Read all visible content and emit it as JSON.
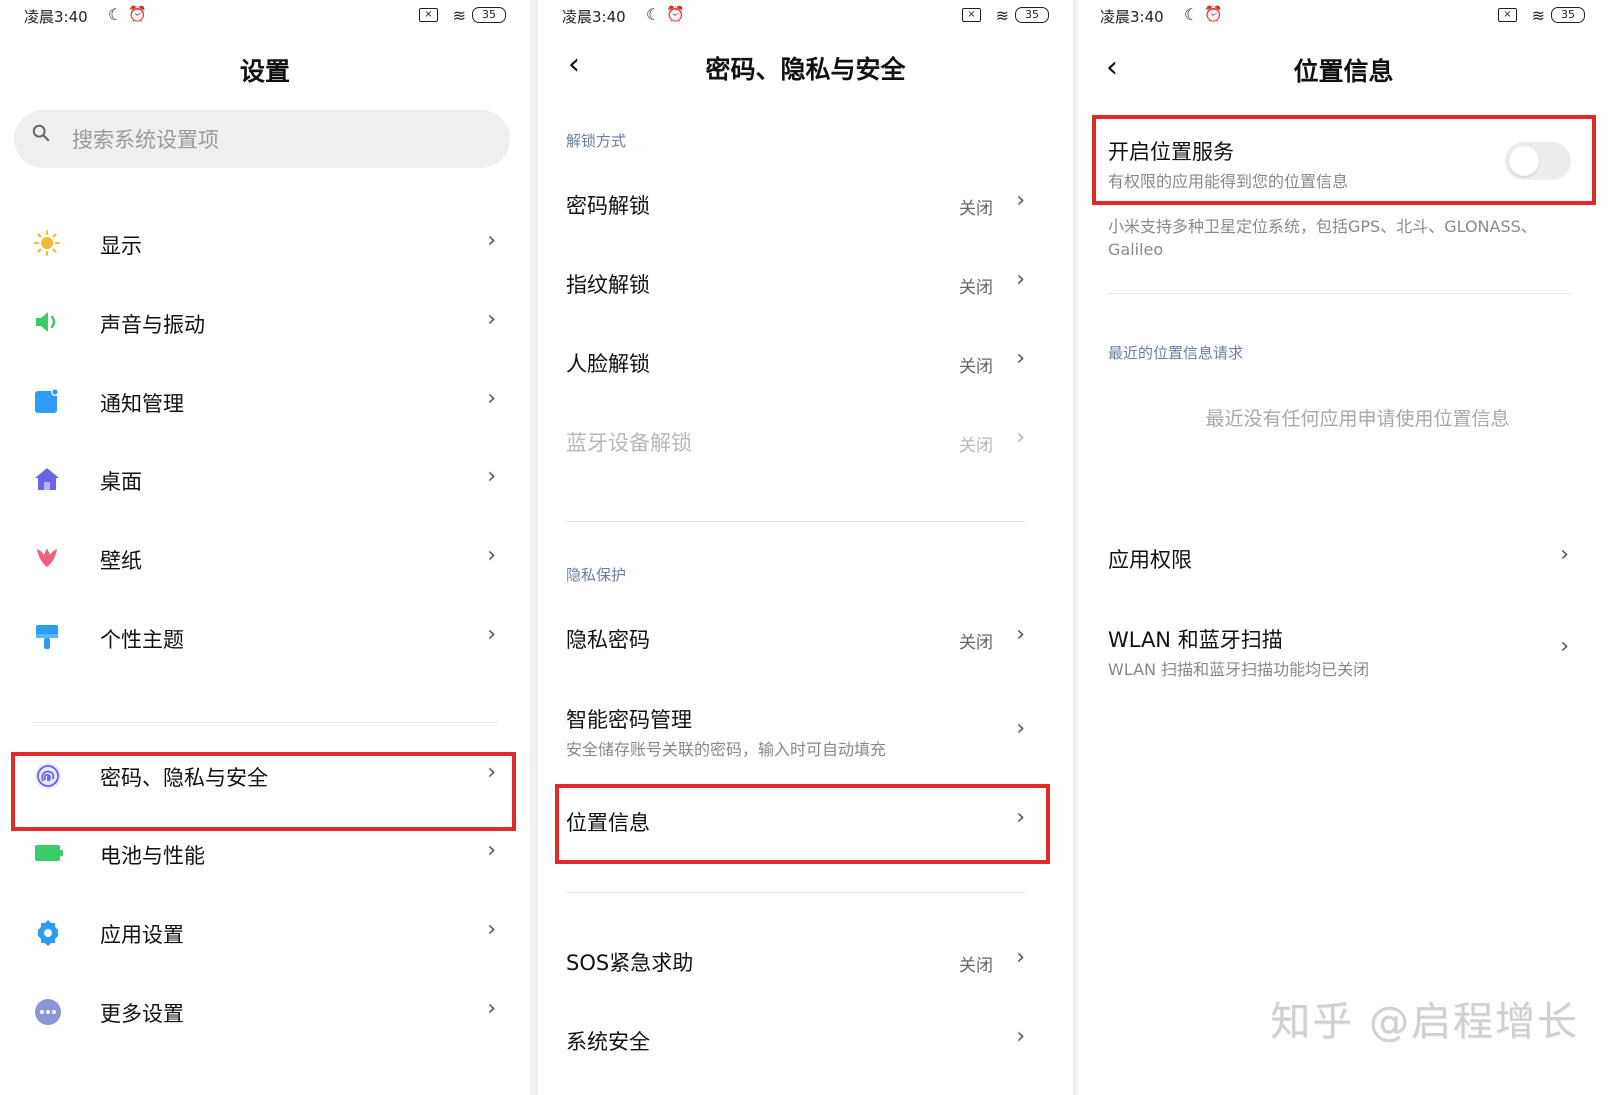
{
  "status_bar": {
    "time": "凌晨3:40",
    "battery": "35"
  },
  "panel1": {
    "title": "设置",
    "search_placeholder": "搜索系统设置项",
    "items": [
      {
        "label": "显示",
        "icon": "sun-icon",
        "color": "#f5b82e"
      },
      {
        "label": "声音与振动",
        "icon": "speaker-icon",
        "color": "#3ccb6a"
      },
      {
        "label": "通知管理",
        "icon": "notification-icon",
        "color": "#2d9cf5"
      },
      {
        "label": "桌面",
        "icon": "home-icon",
        "color": "#6c63e8"
      },
      {
        "label": "壁纸",
        "icon": "tulip-icon",
        "color": "#f06080"
      },
      {
        "label": "个性主题",
        "icon": "brush-icon",
        "color": "#2d9cf5"
      },
      {
        "label": "密码、隐私与安全",
        "icon": "fingerprint-icon",
        "color": "#6c63e8"
      },
      {
        "label": "电池与性能",
        "icon": "battery-icon",
        "color": "#3ccb6a"
      },
      {
        "label": "应用设置",
        "icon": "gear-icon",
        "color": "#2d9cf5"
      },
      {
        "label": "更多设置",
        "icon": "more-icon",
        "color": "#8c95d8"
      }
    ]
  },
  "panel2": {
    "title": "密码、隐私与安全",
    "section_unlock": "解锁方式",
    "section_privacy": "隐私保护",
    "unlock_items": [
      {
        "label": "密码解锁",
        "value": "关闭"
      },
      {
        "label": "指纹解锁",
        "value": "关闭"
      },
      {
        "label": "人脸解锁",
        "value": "关闭"
      },
      {
        "label": "蓝牙设备解锁",
        "value": "关闭"
      }
    ],
    "privacy_items": [
      {
        "label": "隐私密码",
        "value": "关闭"
      },
      {
        "label": "智能密码管理",
        "sub": "安全储存账号关联的密码，输入时可自动填充"
      },
      {
        "label": "位置信息"
      }
    ],
    "other_items": [
      {
        "label": "SOS紧急求助",
        "value": "关闭"
      },
      {
        "label": "系统安全"
      }
    ]
  },
  "panel3": {
    "title": "位置信息",
    "location_service": {
      "label": "开启位置服务",
      "sub": "有权限的应用能得到您的位置信息",
      "enabled": false
    },
    "description": "小米支持多种卫星定位系统，包括GPS、北斗、GLONASS、Galileo",
    "section_recent": "最近的位置信息请求",
    "empty_message": "最近没有任何应用申请使用位置信息",
    "items": [
      {
        "label": "应用权限"
      },
      {
        "label": "WLAN 和蓝牙扫描",
        "sub": "WLAN 扫描和蓝牙扫描功能均已关闭"
      }
    ]
  },
  "watermark": "知乎 @启程增长"
}
